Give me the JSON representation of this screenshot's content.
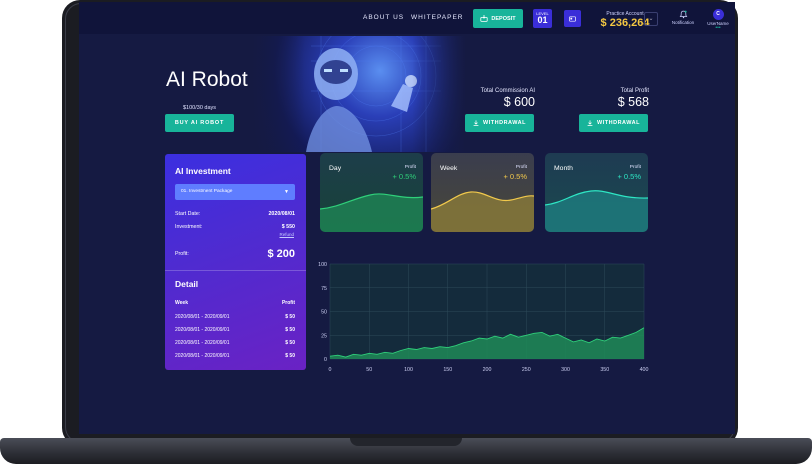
{
  "nav": {
    "about": "ABOUT US",
    "whitepaper": "WHITEPAPER"
  },
  "header": {
    "deposit_label": "DEPOSIT",
    "level_label": "LEVEL",
    "level_value": "01",
    "account_label": "Practice Account",
    "account_balance": "$ 236,264",
    "notification_label": "Notification",
    "user_initial": "C",
    "username_label": "UserName"
  },
  "hero": {
    "title": "AI Robot",
    "price_note": "$100/30 days",
    "buy_label": "BUY AI ROBOT",
    "commission_label": "Total Commission AI",
    "commission_value": "$ 600",
    "profit_label": "Total Profit",
    "profit_value": "$ 568",
    "withdrawal_label": "WITHDRAWAL"
  },
  "investment": {
    "title": "AI Investment",
    "package": "01. Investment Package",
    "start_label": "Start Date:",
    "start_value": "2020/08/01",
    "investment_label": "Investment:",
    "investment_value": "$ 550",
    "refund_label": "Refund",
    "profit_label": "Profit:",
    "profit_value": "$ 200"
  },
  "detail": {
    "title": "Detail",
    "col_week": "Week",
    "col_profit": "Profit",
    "rows": [
      {
        "week": "2020/08/01 - 2020/09/01",
        "profit": "$ 50"
      },
      {
        "week": "2020/08/01 - 2020/09/01",
        "profit": "$ 50"
      },
      {
        "week": "2020/08/01 - 2020/09/01",
        "profit": "$ 50"
      },
      {
        "week": "2020/08/01 - 2020/09/01",
        "profit": "$ 50"
      }
    ]
  },
  "periods": [
    {
      "name": "Day",
      "profit_label": "Profit",
      "profit_value": "+ 0.5%",
      "color": "#2fd07a"
    },
    {
      "name": "Week",
      "profit_label": "Profit",
      "profit_value": "+ 0.5%",
      "color": "#f2c94c"
    },
    {
      "name": "Month",
      "profit_label": "Profit",
      "profit_value": "+ 0.5%",
      "color": "#2ee6c4"
    }
  ],
  "colors": {
    "accent": "#18b49a",
    "panel": "#151a42",
    "purple": "#3a2ed8",
    "gold": "#f5c842"
  },
  "chart_data": {
    "type": "area",
    "title": "",
    "xlabel": "",
    "ylabel": "",
    "xlim": [
      0,
      400
    ],
    "ylim": [
      0,
      100
    ],
    "x_ticks": [
      0,
      50,
      100,
      150,
      200,
      250,
      300,
      350,
      400
    ],
    "y_ticks": [
      0,
      25,
      50,
      75,
      100
    ],
    "grid": true,
    "series": [
      {
        "color": "#2fd07a",
        "x": [
          0,
          10,
          20,
          30,
          40,
          50,
          60,
          70,
          80,
          90,
          100,
          110,
          120,
          130,
          140,
          150,
          160,
          170,
          180,
          190,
          200,
          210,
          220,
          230,
          240,
          250,
          260,
          270,
          280,
          290,
          300,
          310,
          320,
          330,
          340,
          350,
          360,
          370,
          380,
          390,
          400
        ],
        "values": [
          3,
          4,
          2,
          5,
          4,
          6,
          5,
          7,
          6,
          9,
          11,
          10,
          12,
          11,
          13,
          12,
          14,
          17,
          19,
          22,
          21,
          24,
          22,
          26,
          23,
          25,
          27,
          28,
          24,
          26,
          22,
          18,
          20,
          17,
          21,
          19,
          23,
          22,
          25,
          28,
          33
        ]
      }
    ]
  }
}
